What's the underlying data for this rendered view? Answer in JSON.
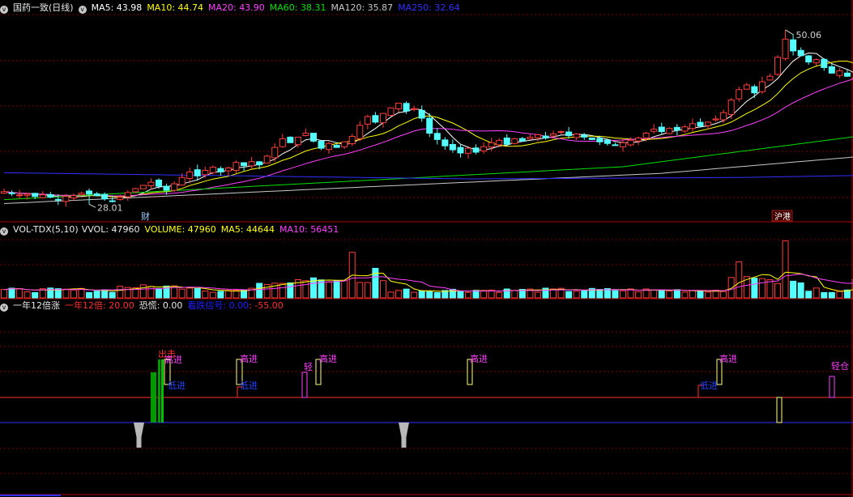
{
  "main_header": {
    "title": "国药一致(日线)",
    "ma5": "MA5: 43.98",
    "ma10": "MA10: 44.74",
    "ma20": "MA20: 43.90",
    "ma60": "MA60: 38.31",
    "ma120": "MA120: 35.87",
    "ma250": "MA250: 32.64"
  },
  "vol_header": {
    "title": "VOL-TDX(5,10)",
    "vvol": "VVOL: 47960",
    "volume": "VOLUME: 47960",
    "ma5": "MA5: 44644",
    "ma10": "MA10: 56451"
  },
  "ind_header": {
    "title": "一年12倍涨",
    "v1": "一年12倍: 20.00",
    "v2": "恐慌: 0.00",
    "v3": "看跌信号: 0.00",
    "v4": ": -55.00"
  },
  "price_labels": {
    "high": "50.06",
    "low": "28.01",
    "cai": "财",
    "gangtong": "沪港"
  },
  "signals": {
    "chuji": "出击",
    "gaojin": "高进",
    "dijin": "低进",
    "qing": "轻",
    "qingcang": "轻仓"
  },
  "colors": {
    "up": "#ff3c3c",
    "down": "#54ffff",
    "ma5": "#ffffff",
    "ma10": "#ffff00",
    "ma20": "#ff40ff",
    "ma60": "#00e000",
    "ma120": "#c8c8c8",
    "ma250": "#3030ff",
    "grid": "#7a0000"
  },
  "chart_data": {
    "type": "candlestick",
    "ylim": [
      26,
      52
    ],
    "high_marker": 50.06,
    "low_marker": 28.01,
    "closes": [
      29.6,
      29.4,
      29.2,
      29.3,
      29.0,
      29.2,
      28.9,
      28.6,
      29.0,
      29.1,
      29.4,
      29.3,
      29.1,
      28.7,
      28.4,
      28.9,
      29.5,
      30.0,
      30.4,
      30.8,
      30.3,
      29.8,
      30.6,
      31.4,
      32.1,
      31.6,
      32.3,
      32.7,
      32.1,
      32.6,
      33.3,
      32.9,
      33.4,
      33.0,
      34.1,
      35.2,
      36.3,
      35.8,
      36.5,
      37.0,
      36.0,
      35.1,
      35.7,
      35.2,
      35.9,
      36.6,
      38.0,
      39.1,
      38.4,
      39.5,
      40.2,
      40.8,
      39.8,
      40.1,
      38.9,
      37.0,
      36.2,
      35.4,
      34.9,
      34.5,
      35.1,
      34.6,
      35.3,
      35.8,
      36.1,
      35.6,
      36.3,
      36.0,
      36.5,
      36.8,
      36.4,
      36.9,
      37.2,
      36.7,
      36.9,
      36.5,
      36.2,
      35.9,
      35.7,
      35.5,
      35.8,
      36.1,
      36.4,
      37.0,
      37.5,
      37.2,
      37.6,
      37.4,
      37.8,
      38.2,
      37.9,
      38.4,
      38.8,
      39.6,
      41.2,
      42.5,
      43.1,
      42.1,
      43.5,
      44.2,
      46.6,
      48.9,
      47.4,
      46.8,
      46.0,
      46.3,
      45.3,
      44.6,
      44.9,
      44.2,
      43.98
    ],
    "volume_ma5_last": 44644,
    "volume_ma10_last": 56451,
    "volume_last": 47960
  }
}
